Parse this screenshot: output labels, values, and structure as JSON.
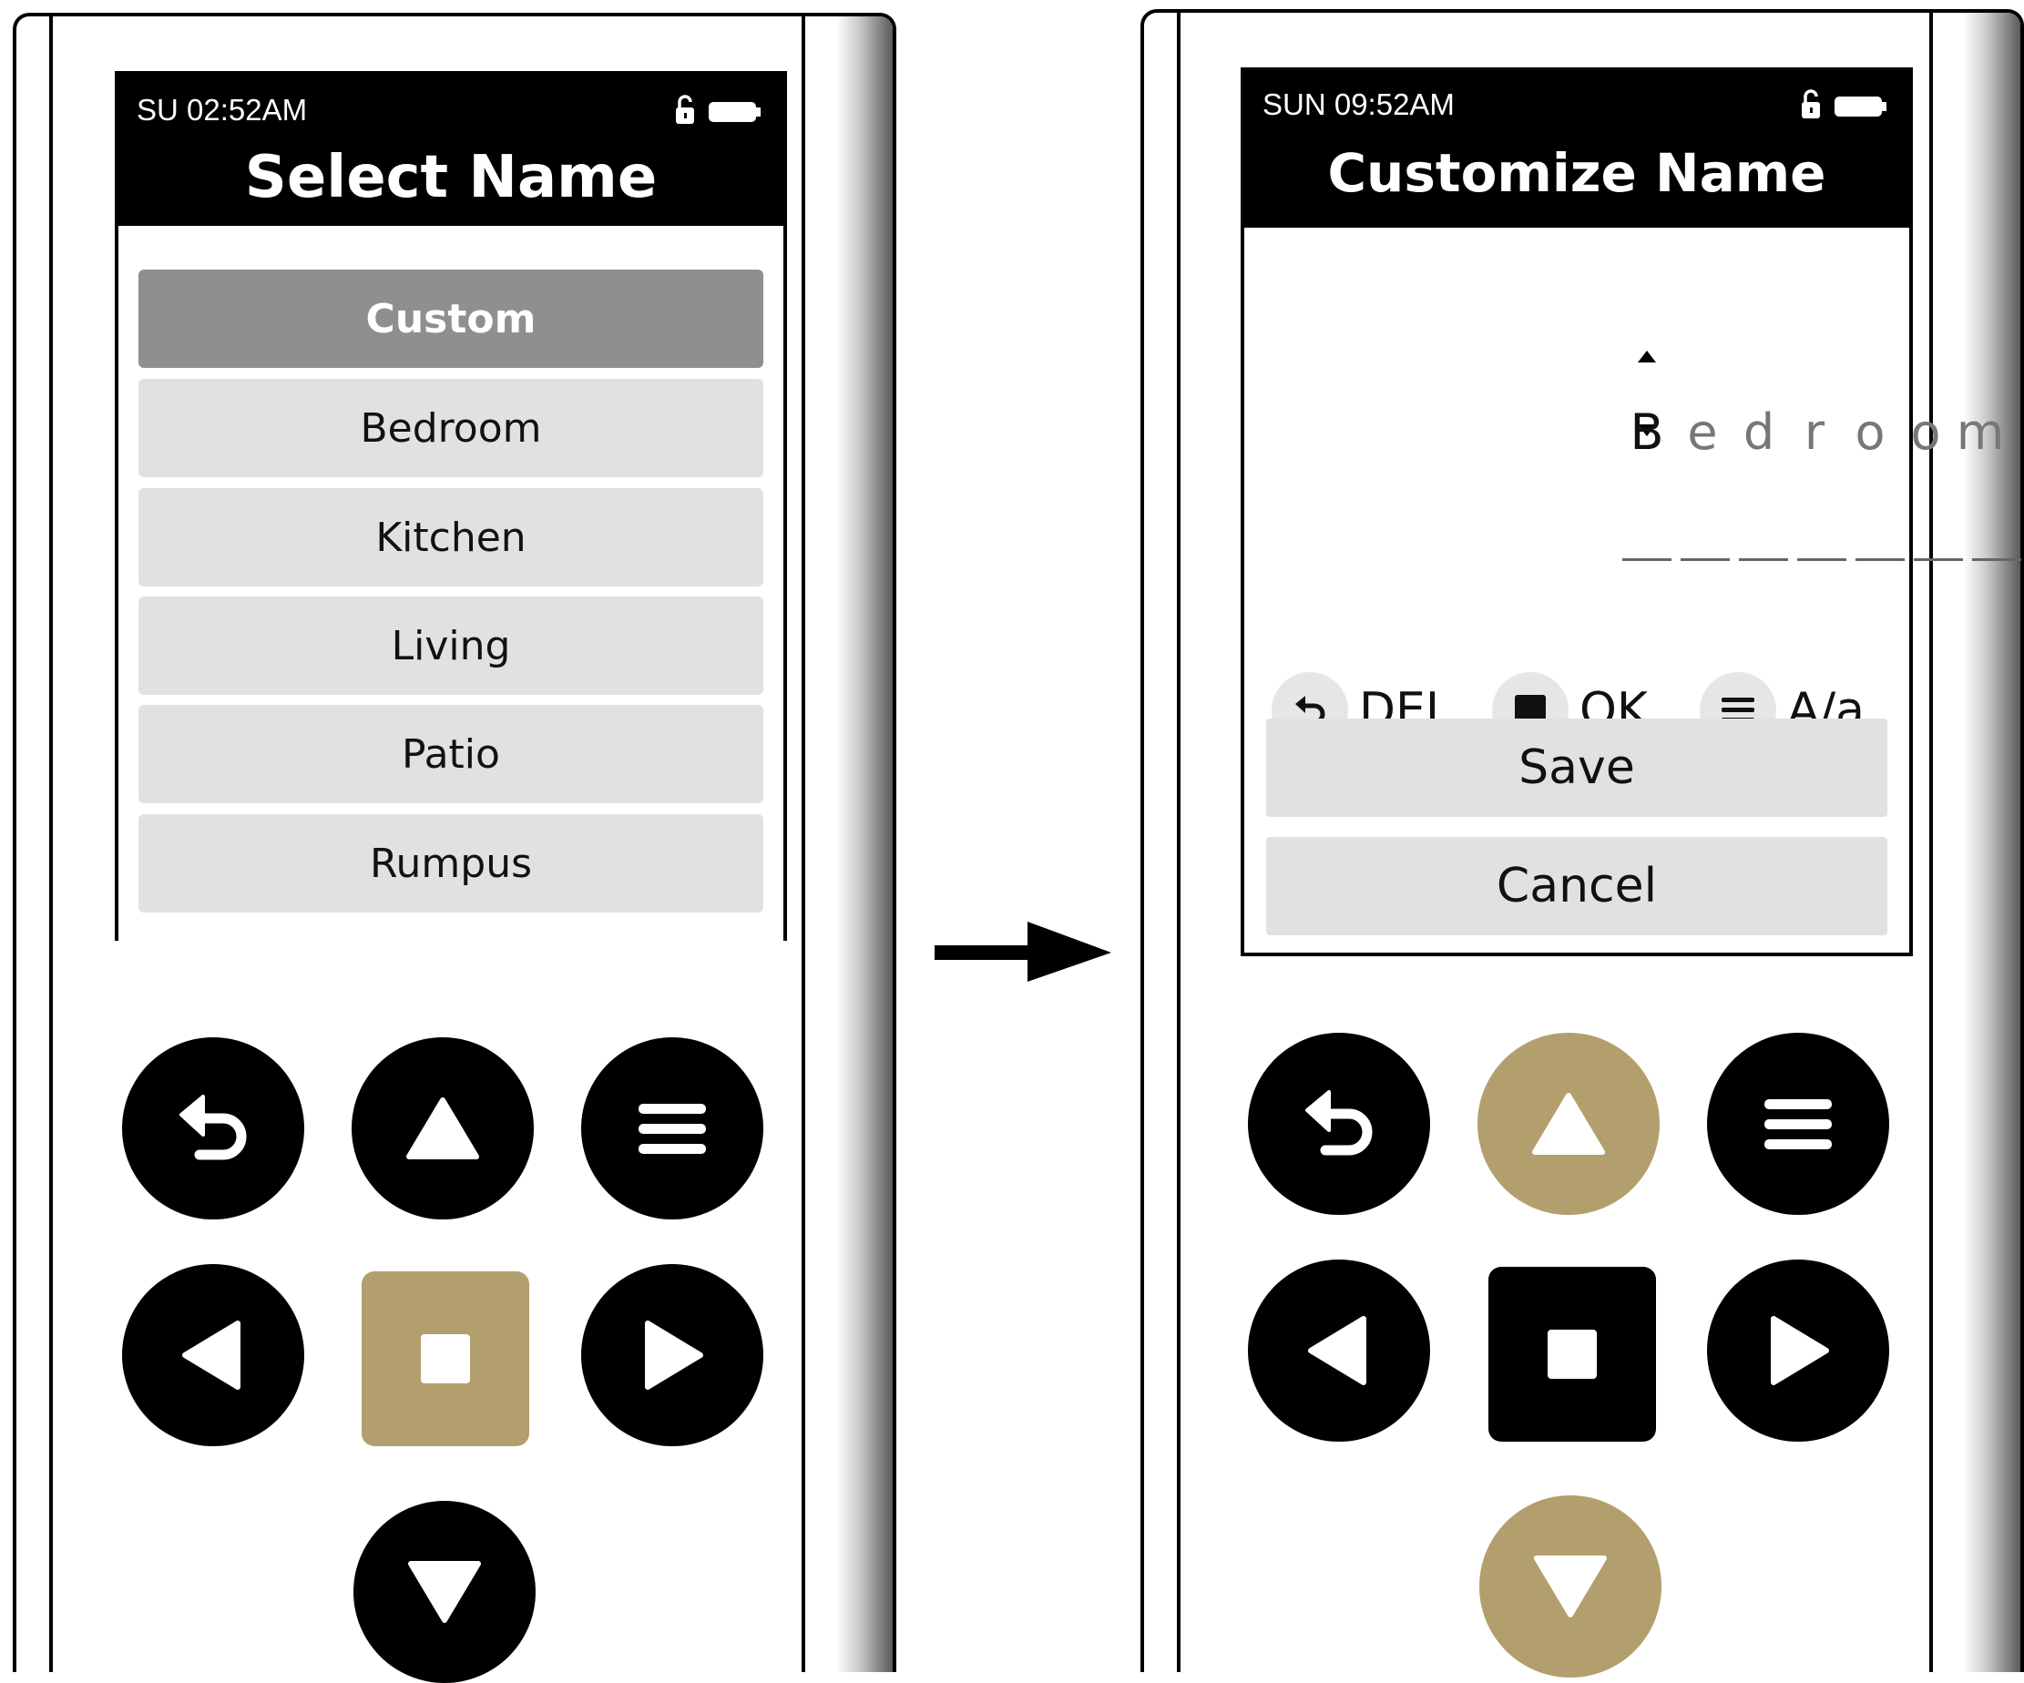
{
  "left_device": {
    "status_time": "SU 02:52AM",
    "title": "Select Name",
    "items": [
      "Custom",
      "Bedroom",
      "Kitchen",
      "Living",
      "Patio",
      "Rumpus"
    ],
    "selected_item": "Custom"
  },
  "right_device": {
    "status_time": "SUN 09:52AM",
    "title": "Customize Name",
    "name_chars": [
      "B",
      "e",
      "d",
      "r",
      "o",
      "o",
      "m"
    ],
    "active_char_index": 0,
    "actions": {
      "delete_label": "DEL",
      "ok_label": "OK",
      "case_label": "A/a"
    },
    "save_label": "Save",
    "cancel_label": "Cancel"
  },
  "keypad_state": {
    "left": {
      "highlighted": [
        "ok"
      ]
    },
    "right": {
      "highlighted": [
        "up",
        "down"
      ]
    }
  },
  "colors": {
    "header_bg": "#000000",
    "selected_item_bg": "#8f8f8f",
    "item_bg": "#e1e1e1",
    "highlight_button": "#b39f6e",
    "button": "#000000"
  },
  "icons": [
    "back-icon",
    "up-arrow-icon",
    "menu-icon",
    "left-arrow-icon",
    "stop-square-icon",
    "right-arrow-icon",
    "down-arrow-icon",
    "lock-open-icon",
    "battery-icon",
    "transition-arrow-icon"
  ]
}
